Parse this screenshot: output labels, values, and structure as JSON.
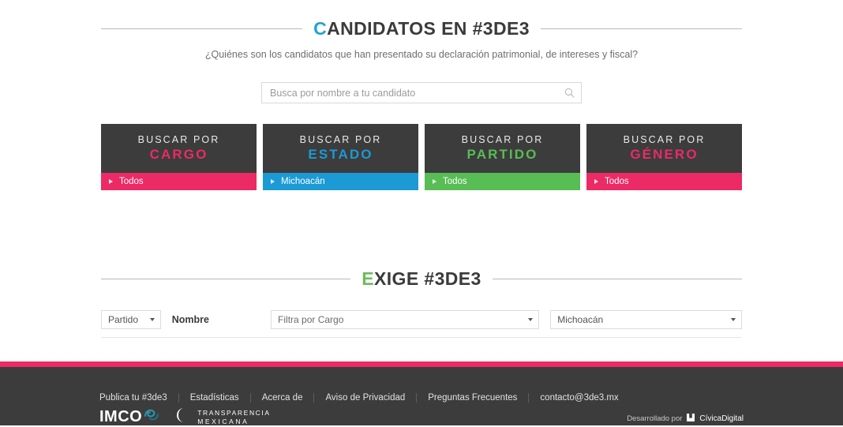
{
  "sections": {
    "candidatos": {
      "title_accent": "C",
      "title_rest": "ANDIDATOS EN #3DE3",
      "subtitle": "¿Quiénes son los candidatos que han presentado su declaración patrimonial, de intereses y fiscal?"
    },
    "exige": {
      "title_accent": "E",
      "title_rest": "XIGE #3DE3"
    }
  },
  "search": {
    "placeholder": "Busca por nombre a tu candidato",
    "value": "",
    "icon": "search-icon"
  },
  "filter_cards": [
    {
      "line1": "BUSCAR POR",
      "line2": "CARGO",
      "value": "Todos",
      "accent": "#ec2a66"
    },
    {
      "line1": "BUSCAR POR",
      "line2": "ESTADO",
      "value": "Michoacán",
      "accent": "#1b9ad6"
    },
    {
      "line1": "BUSCAR POR",
      "line2": "PARTIDO",
      "value": "Todos",
      "accent": "#58bd54"
    },
    {
      "line1": "BUSCAR POR",
      "line2": "GÉNERO",
      "value": "Todos",
      "accent": "#ec2a66"
    }
  ],
  "form": {
    "partido_select": "Partido",
    "nombre_label": "Nombre",
    "cargo_select": "Filtra por Cargo",
    "estado_select": "Michoacán"
  },
  "footer": {
    "links": [
      "Publica tu #3de3",
      "Estadísticas",
      "Acerca de",
      "Aviso de Privacidad",
      "Preguntas Frecuentes",
      "contacto@3de3.mx"
    ],
    "logos": {
      "imco": "IMCO",
      "transparencia_line1": "TRANSPARENCIA",
      "transparencia_line2": "MEXICANA"
    },
    "credit_prefix": "Desarrollado por",
    "credit_name": "CívicaDigital"
  },
  "colors": {
    "pink": "#ec2a66",
    "blue": "#1b9ad6",
    "green": "#58bd54",
    "cyan": "#21a3d0",
    "dark": "#3c3c3c"
  }
}
